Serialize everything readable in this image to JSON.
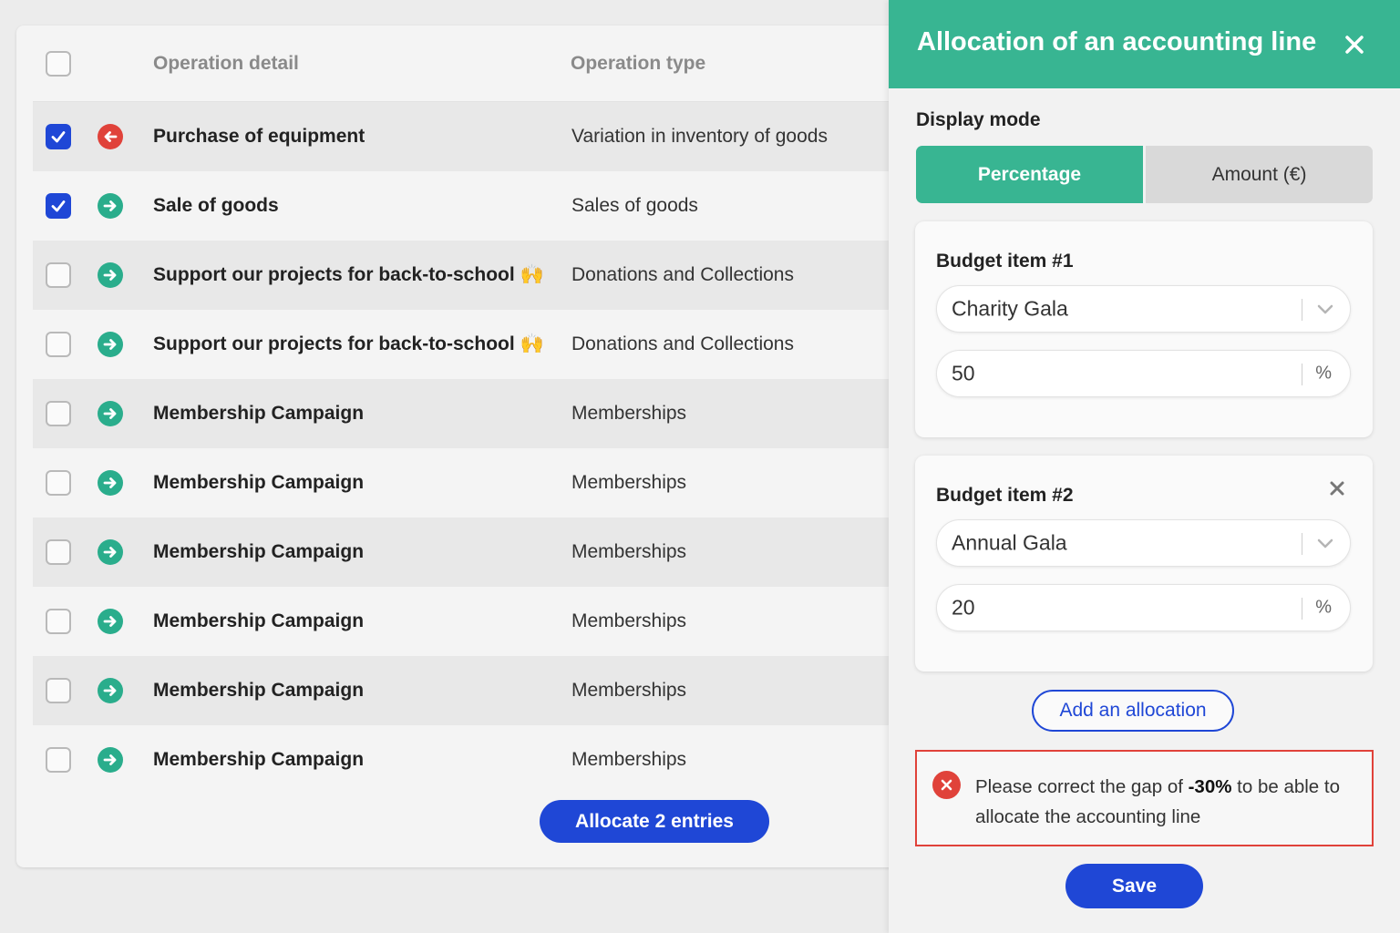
{
  "table": {
    "headers": {
      "detail": "Operation detail",
      "type": "Operation type"
    },
    "rows": [
      {
        "detail": "Purchase of equipment",
        "type": "Variation in inventory of goods",
        "checked": true,
        "direction": "out",
        "direction_icon": "arrow-left-icon",
        "emoji": ""
      },
      {
        "detail": "Sale of goods",
        "type": "Sales of goods",
        "checked": true,
        "direction": "in",
        "direction_icon": "arrow-right-icon",
        "emoji": ""
      },
      {
        "detail": "Support our projects for back-to-school",
        "type": "Donations and Collections",
        "checked": false,
        "direction": "in",
        "direction_icon": "arrow-right-icon",
        "emoji": "🙌"
      },
      {
        "detail": "Support our projects for back-to-school",
        "type": "Donations and Collections",
        "checked": false,
        "direction": "in",
        "direction_icon": "arrow-right-icon",
        "emoji": "🙌"
      },
      {
        "detail": "Membership Campaign",
        "type": "Memberships",
        "checked": false,
        "direction": "in",
        "direction_icon": "arrow-right-icon",
        "emoji": ""
      },
      {
        "detail": "Membership Campaign",
        "type": "Memberships",
        "checked": false,
        "direction": "in",
        "direction_icon": "arrow-right-icon",
        "emoji": ""
      },
      {
        "detail": "Membership Campaign",
        "type": "Memberships",
        "checked": false,
        "direction": "in",
        "direction_icon": "arrow-right-icon",
        "emoji": ""
      },
      {
        "detail": "Membership Campaign",
        "type": "Memberships",
        "checked": false,
        "direction": "in",
        "direction_icon": "arrow-right-icon",
        "emoji": ""
      },
      {
        "detail": "Membership Campaign",
        "type": "Memberships",
        "checked": false,
        "direction": "in",
        "direction_icon": "arrow-right-icon",
        "emoji": ""
      },
      {
        "detail": "Membership Campaign",
        "type": "Memberships",
        "checked": false,
        "direction": "in",
        "direction_icon": "arrow-right-icon",
        "emoji": ""
      }
    ],
    "allocate_button": "Allocate 2 entries"
  },
  "panel": {
    "title": "Allocation of an accounting line",
    "close_icon": "close-icon",
    "display_mode_label": "Display mode",
    "modes": {
      "percentage": "Percentage",
      "amount": "Amount (€)",
      "active": "percentage"
    },
    "budget_items": [
      {
        "title": "Budget item #1",
        "selection": "Charity Gala",
        "value": "50",
        "suffix": "%",
        "removable": false
      },
      {
        "title": "Budget item #2",
        "selection": "Annual Gala",
        "value": "20",
        "suffix": "%",
        "removable": true
      }
    ],
    "add_allocation": "Add an allocation",
    "alert": {
      "text_before": "Please correct the gap of ",
      "gap": "-30%",
      "text_after": " to be able to allocate the accounting line"
    },
    "save": "Save"
  },
  "colors": {
    "accent_green": "#38b592",
    "primary_blue": "#1f47d6",
    "error_red": "#e0423a",
    "arrow_in": "#2aad8c",
    "arrow_out": "#e0423a"
  }
}
